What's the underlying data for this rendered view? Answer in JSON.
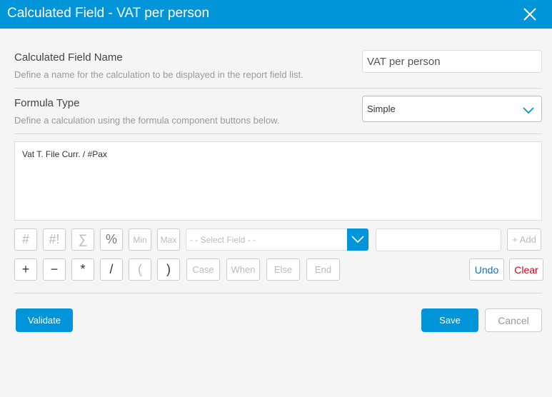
{
  "window": {
    "title": "Calculated Field - VAT per person"
  },
  "name_section": {
    "label": "Calculated Field Name",
    "description": "Define a name for the calculation to be displayed in the report field list.",
    "value": "VAT per person"
  },
  "formula_type": {
    "label": "Formula Type",
    "description": "Define a calculation using the formula component buttons below.",
    "selected": "Simple"
  },
  "formula": {
    "text": "Vat T. File Curr. / #Pax"
  },
  "toolbar_row1": {
    "hash": "#",
    "hash_bang": "#!",
    "sigma": "∑",
    "percent": "%",
    "min": "Min",
    "max": "Max",
    "field_placeholder": "- - Select Field - -",
    "add": "+ Add"
  },
  "toolbar_row2": {
    "plus": "+",
    "minus": "−",
    "multiply": "*",
    "divide": "/",
    "open_paren": "(",
    "close_paren": ")",
    "case": "Case",
    "when": "When",
    "else": "Else",
    "end": "End",
    "undo": "Undo",
    "clear": "Clear"
  },
  "footer": {
    "validate": "Validate",
    "save": "Save",
    "cancel": "Cancel"
  },
  "icons": {
    "close": "close-icon",
    "dropdown": "chevron-down-icon"
  },
  "colors": {
    "accent": "#0094d9",
    "undo": "#1a6fb3",
    "clear": "#d0021b"
  }
}
